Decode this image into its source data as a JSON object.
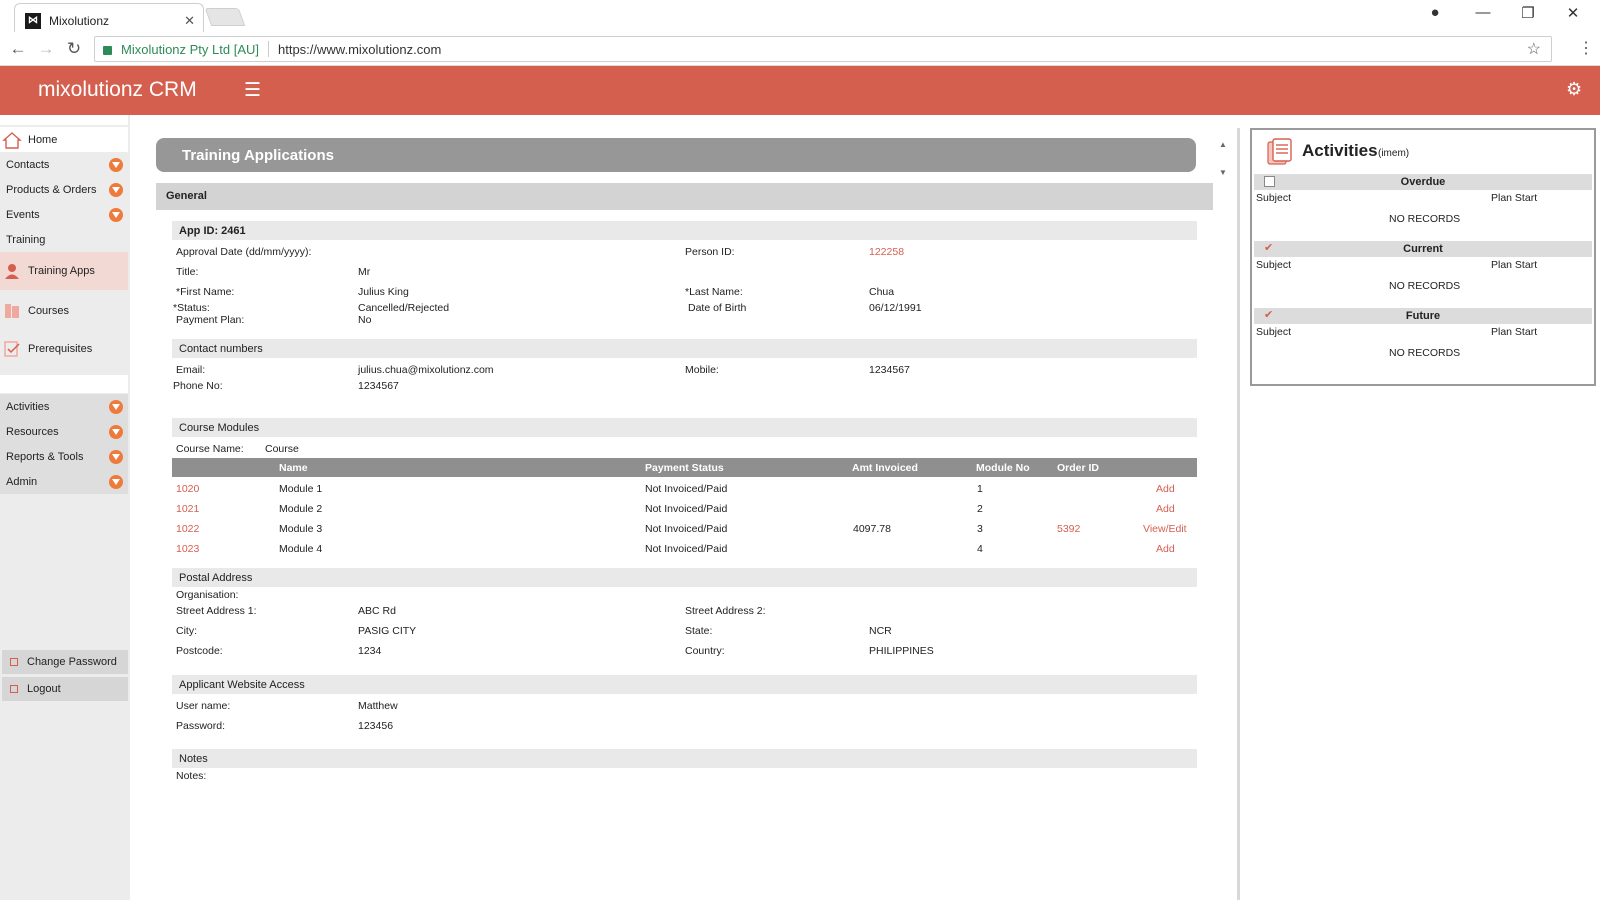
{
  "browser": {
    "tab_title": "Mixolutionz",
    "tab_close": "✕",
    "site_owner": "Mixolutionz Pty Ltd [AU]",
    "url": "https://www.mixolutionz.com"
  },
  "header": {
    "brand": "mixolutionz CRM"
  },
  "sidebar": {
    "items": [
      {
        "label": "Home"
      },
      {
        "label": "Contacts"
      },
      {
        "label": "Products & Orders"
      },
      {
        "label": "Events"
      },
      {
        "label": "Training"
      },
      {
        "label": "Training Apps"
      },
      {
        "label": "Courses"
      },
      {
        "label": "Prerequisites"
      },
      {
        "label": "Activities"
      },
      {
        "label": "Resources"
      },
      {
        "label": "Reports & Tools"
      },
      {
        "label": "Admin"
      }
    ],
    "change_password": "Change Password",
    "logout": "Logout"
  },
  "page": {
    "title": "Training Applications",
    "general": "General"
  },
  "app": {
    "section_label": "App ID: 2461",
    "approval_date_label": "Approval Date (dd/mm/yyyy):",
    "person_id_label": "Person ID:",
    "person_id": "122258",
    "title_label": "Title:",
    "title": "Mr",
    "first_name_label": "*First Name:",
    "first_name": "Julius King",
    "last_name_label": "*Last Name:",
    "last_name": "Chua",
    "status_label": "*Status:",
    "status": "Cancelled/Rejected",
    "dob_label": "Date of Birth",
    "dob": "06/12/1991",
    "payment_plan_label": "Payment Plan:",
    "payment_plan": "No"
  },
  "contact": {
    "section_label": "Contact numbers",
    "email_label": "Email:",
    "email": "julius.chua@mixolutionz.com",
    "mobile_label": "Mobile:",
    "mobile": "1234567",
    "phone_label": "Phone No:",
    "phone": "1234567"
  },
  "modules": {
    "section_label": "Course Modules",
    "course_name_label": "Course Name:",
    "course_name": "Course",
    "columns": {
      "name": "Name",
      "payment_status": "Payment Status",
      "amt_invoiced": "Amt Invoiced",
      "module_no": "Module No",
      "order_id": "Order ID"
    },
    "rows": [
      {
        "id": "1020",
        "name": "Module 1",
        "payment_status": "Not Invoiced/Paid",
        "amt_invoiced": "",
        "module_no": "1",
        "order_id": "",
        "action": "Add"
      },
      {
        "id": "1021",
        "name": "Module 2",
        "payment_status": "Not Invoiced/Paid",
        "amt_invoiced": "",
        "module_no": "2",
        "order_id": "",
        "action": "Add"
      },
      {
        "id": "1022",
        "name": "Module 3",
        "payment_status": "Not Invoiced/Paid",
        "amt_invoiced": "4097.78",
        "module_no": "3",
        "order_id": "5392",
        "action": "View/Edit"
      },
      {
        "id": "1023",
        "name": "Module 4",
        "payment_status": "Not Invoiced/Paid",
        "amt_invoiced": "",
        "module_no": "4",
        "order_id": "",
        "action": "Add"
      }
    ]
  },
  "postal": {
    "section_label": "Postal Address",
    "organisation_label": "Organisation:",
    "street1_label": "Street Address 1:",
    "street1": "ABC Rd",
    "street2_label": "Street Address 2:",
    "city_label": "City:",
    "city": "PASIG CITY",
    "state_label": "State:",
    "state": "NCR",
    "postcode_label": "Postcode:",
    "postcode": "1234",
    "country_label": "Country:",
    "country": "PHILIPPINES"
  },
  "access": {
    "section_label": "Applicant Website Access",
    "username_label": "User name:",
    "username": "Matthew",
    "password_label": "Password:",
    "password": "123456"
  },
  "notes": {
    "section_label": "Notes",
    "notes_label": "Notes:"
  },
  "activities": {
    "title": "Activities",
    "user": "(imem)",
    "groups": [
      {
        "name": "Overdue",
        "subject": "Subject",
        "plan_start": "Plan Start",
        "empty": "NO RECORDS"
      },
      {
        "name": "Current",
        "subject": "Subject",
        "plan_start": "Plan Start",
        "empty": "NO RECORDS"
      },
      {
        "name": "Future",
        "subject": "Subject",
        "plan_start": "Plan Start",
        "empty": "NO RECORDS"
      }
    ]
  },
  "colors": {
    "brand": "#d55f4f",
    "caret": "#ee7a3c",
    "link": "#d55f4f"
  }
}
